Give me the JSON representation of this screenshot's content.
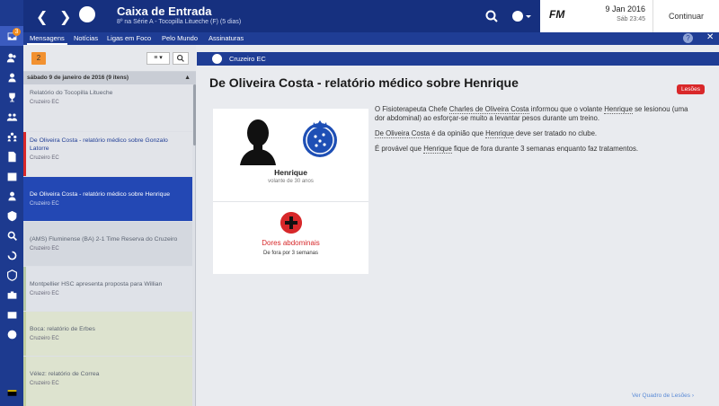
{
  "header": {
    "title": "Caixa de Entrada",
    "subtitle": "8º na Série A - Tocopilla Litueche (F) (5 dias)",
    "back_icon": "chevron-left-icon",
    "forward_icon": "chevron-right-icon",
    "club_icon": "club-crest-icon",
    "search_icon": "search-icon",
    "globe_icon": "globe-icon",
    "fm_logo": "FM",
    "date": "9 Jan 2016",
    "date_sub": "Sáb 23:45",
    "continue_label": "Continuar"
  },
  "rail": {
    "badge_count": "3",
    "icons": [
      "inbox-icon",
      "people-icon",
      "person-icon",
      "trophy-icon",
      "team-icon",
      "team-icon",
      "document-icon",
      "calendar-icon",
      "people-icon",
      "medical-icon",
      "search-icon",
      "transfer-icon",
      "badge-icon",
      "briefcase-icon",
      "coin-icon",
      "flag-icon"
    ]
  },
  "tabs": [
    {
      "label": "Mensagens"
    },
    {
      "label": "Notícias"
    },
    {
      "label": "Ligas em Foco"
    },
    {
      "label": "Pelo Mundo"
    },
    {
      "label": "Assinaturas"
    }
  ],
  "tabbar": {
    "help": "?",
    "close": "✕"
  },
  "list": {
    "unread_count": "2",
    "filter_label": "≡ ▾",
    "group_header": "sábado 9 de janeiro de 2016 (9 itens)",
    "group_arrow": "▲",
    "messages": [
      {
        "title": "Relatório do Tocopilla Litueche",
        "sender": "Cruzeiro EC"
      },
      {
        "title": "De Oliveira Costa - relatório médico sobre Gonzalo Latorre",
        "sender": "Cruzeiro EC"
      },
      {
        "title": "De Oliveira Costa - relatório médico sobre Henrique",
        "sender": "Cruzeiro EC"
      },
      {
        "title": "(AMS) Fluminense (BA) 2-1 Time Reserva do Cruzeiro",
        "sender": "Cruzeiro EC"
      },
      {
        "title": "Montpellier HSC apresenta proposta para Willian",
        "sender": "Cruzeiro EC"
      },
      {
        "title": "Boca: relatório de Erbes",
        "sender": "Cruzeiro EC"
      },
      {
        "title": "Vélez: relatório de Correa",
        "sender": "Cruzeiro EC"
      }
    ]
  },
  "message": {
    "sender": "Cruzeiro EC",
    "title": "De Oliveira Costa - relatório médico sobre Henrique",
    "tag": "Lesões",
    "player_name": "Henrique",
    "player_role": "volante de 30 anos",
    "injury_name": "Dores abdominais",
    "injury_duration": "De fora por 3 semanas",
    "body": {
      "p1_a": "O Fisioterapeuta Chefe ",
      "p1_link1": "Charles de Oliveira Costa",
      "p1_b": " informou que o volante ",
      "p1_link2": "Henrique",
      "p1_c": " se lesionou (uma dor abdominal) ao esforçar-se muito a levantar pesos durante um treino.",
      "p2_link1": "De Oliveira Costa",
      "p2_a": " é da opinião que ",
      "p2_link2": "Henrique",
      "p2_b": " deve ser tratado no clube.",
      "p3_a": "É provável que ",
      "p3_link": "Henrique",
      "p3_b": " fique de fora durante 3 semanas enquanto faz tratamentos."
    },
    "footer_link": "Ver Quadro de Lesões ›"
  }
}
